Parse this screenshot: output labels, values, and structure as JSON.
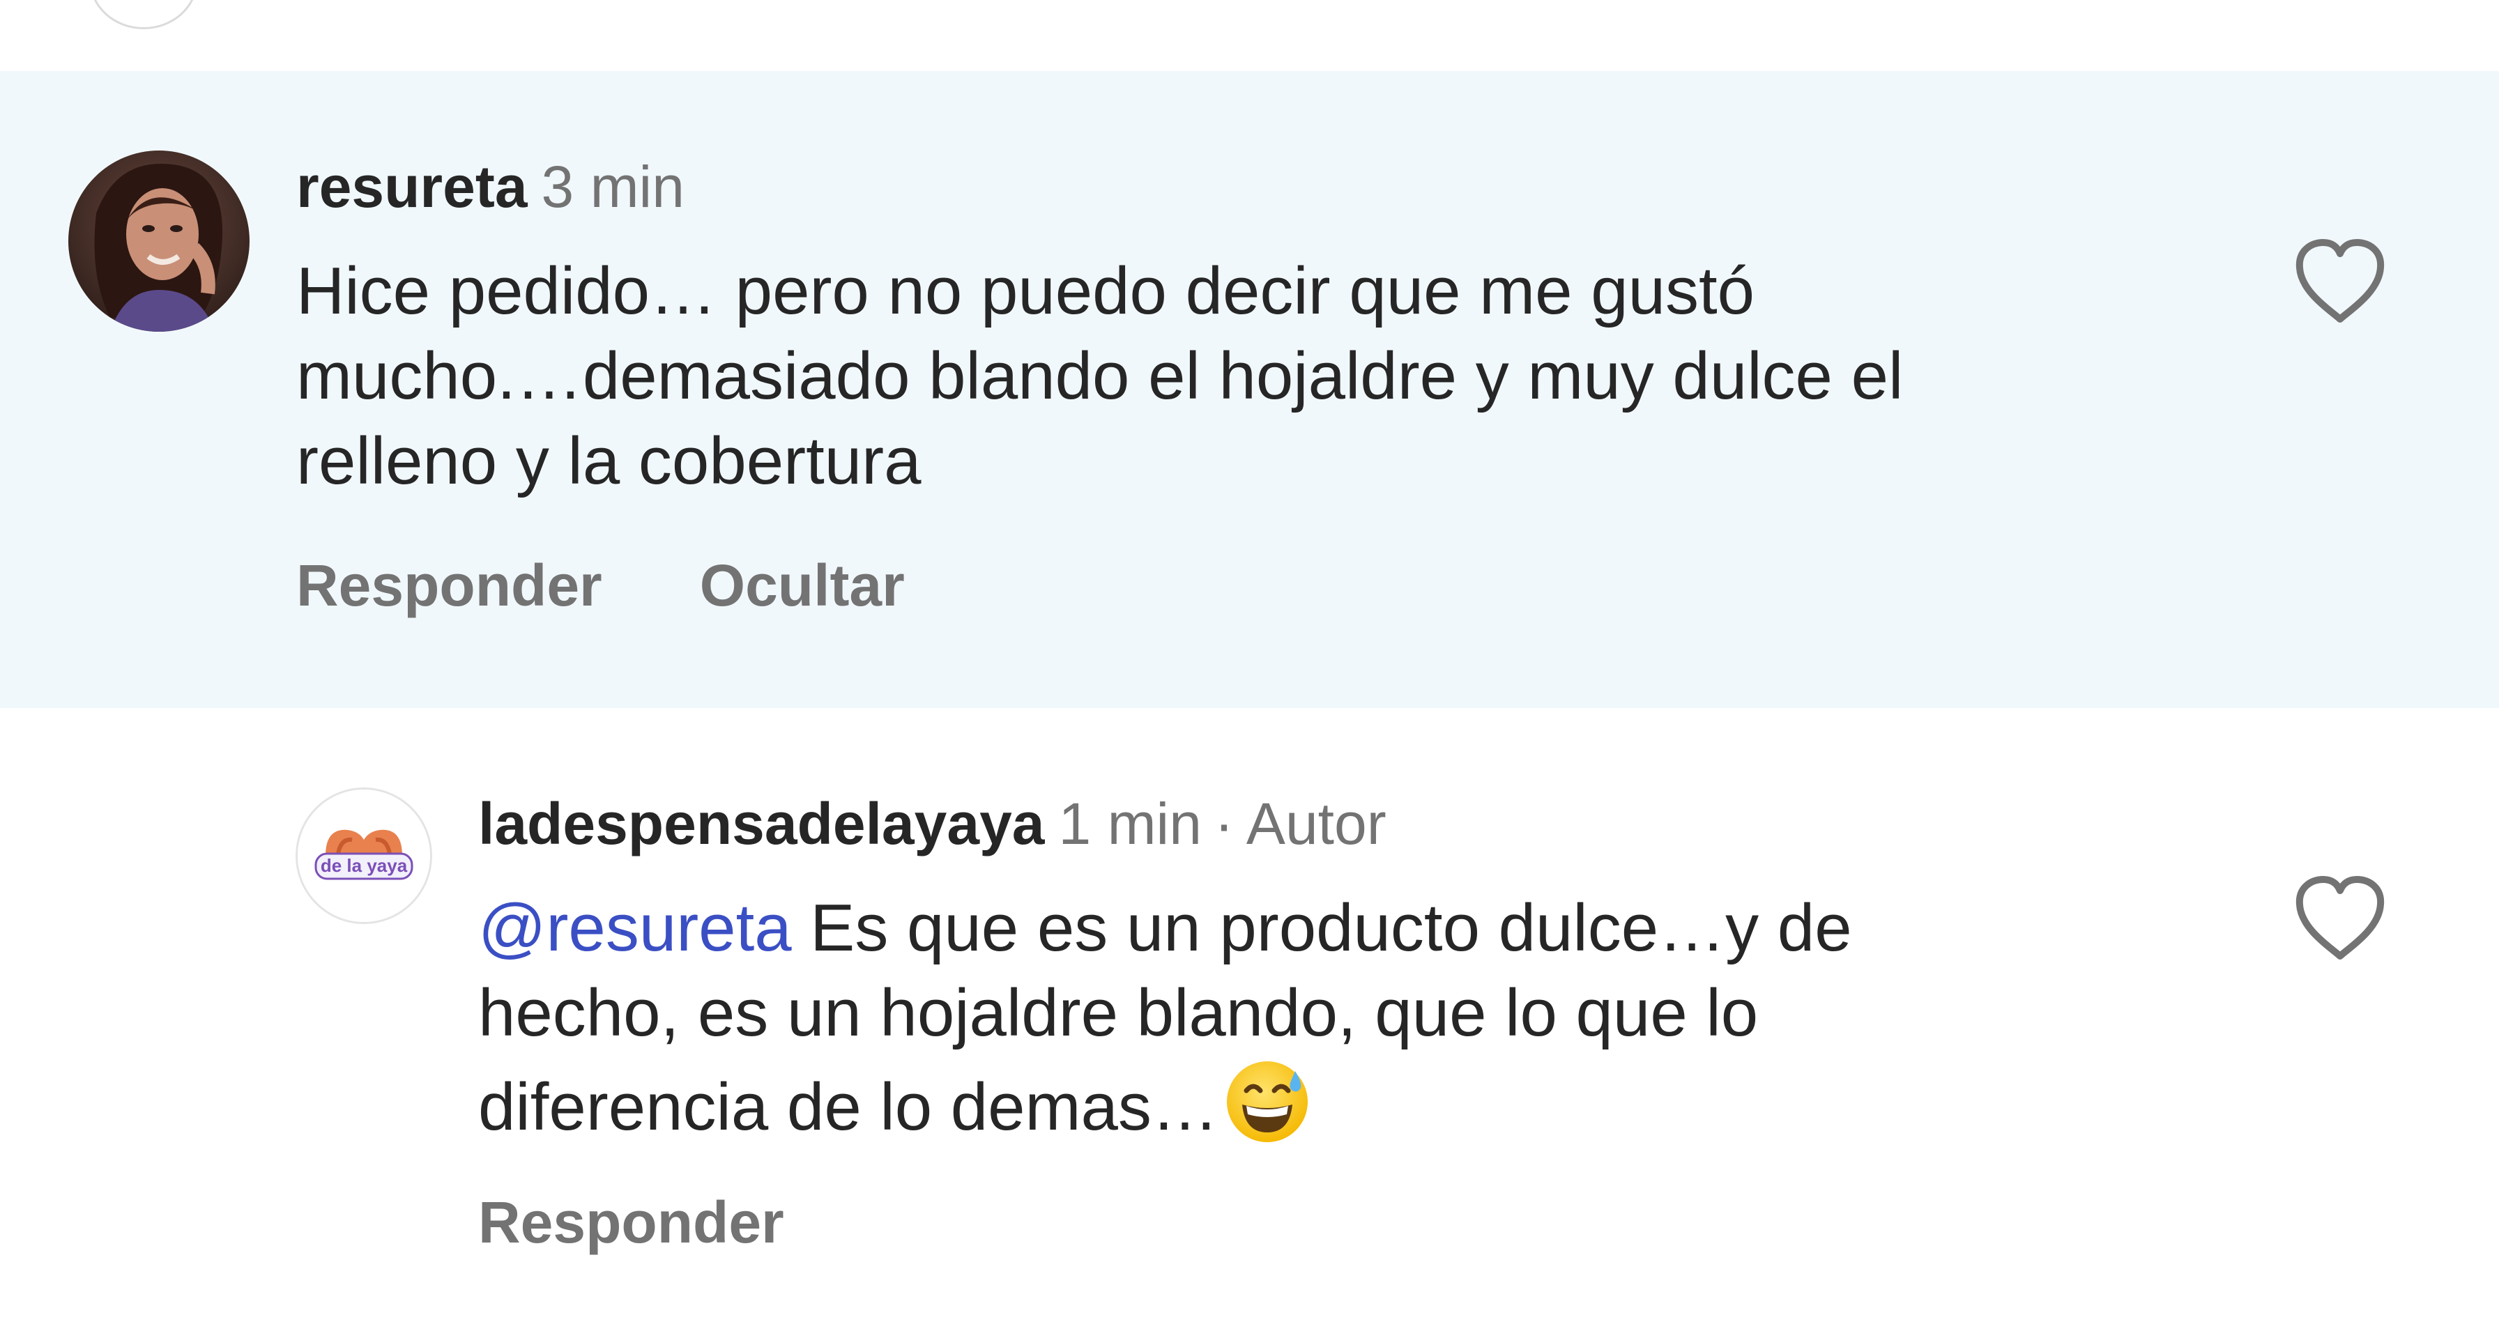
{
  "comments": [
    {
      "username": "resureta",
      "time": "3 min",
      "text": "Hice pedido… pero no puedo decir que me gustó mucho.…demasiado blando el hojaldre y muy dulce el relleno y la cobertura",
      "line1": "Hice pedido… pero no puedo decir que me gustó",
      "line2": "mucho.…demasiado blando el hojaldre y muy dulce el",
      "line3": "relleno y la cobertura",
      "reply_label": "Responder",
      "hide_label": "Ocultar",
      "highlighted": true,
      "avatar_icon": "user-photo-avatar",
      "like_icon": "heart-outline-icon"
    },
    {
      "username": "ladespensadelayaya",
      "time": "1 min",
      "separator": "·",
      "author_label": "Autor",
      "mention": "@resureta",
      "line1_rest": " Es que es un producto dulce…y de",
      "line2": "hecho, es un hojaldre blando, que lo que lo",
      "line3": "diferencia de lo demas…",
      "emoji": "grinning-face-with-sweat-emoji",
      "reply_label": "Responder",
      "avatar_icon": "de-la-yaya-logo-avatar",
      "avatar_logo_text": "de la yaya",
      "like_icon": "heart-outline-icon"
    }
  ],
  "colors": {
    "highlight_bg": "#f1f8fc",
    "text": "#262626",
    "secondary": "#737373",
    "mention": "#3b4fc4"
  }
}
